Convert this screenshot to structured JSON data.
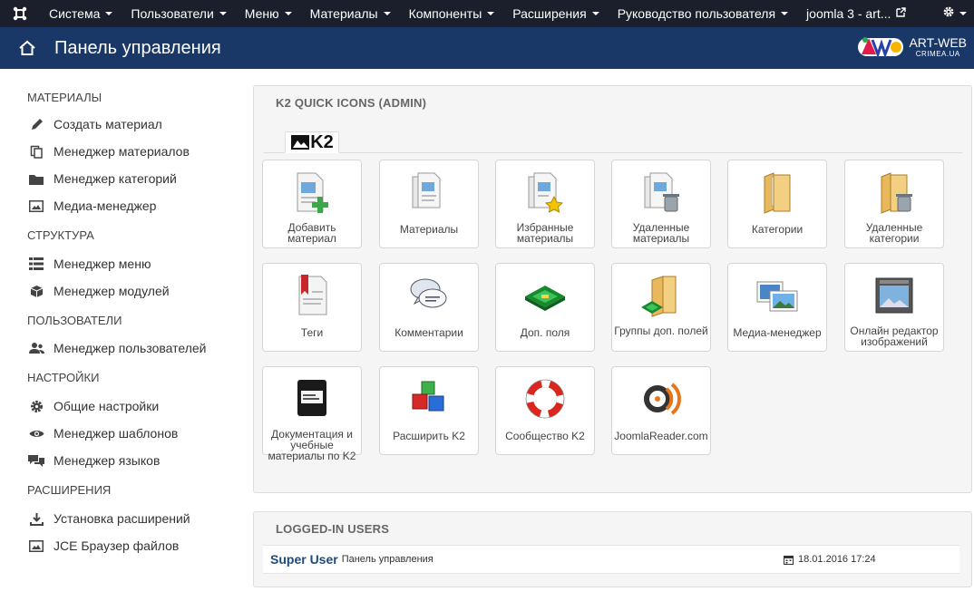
{
  "topnav": {
    "items": [
      {
        "label": "Система",
        "dropdown": true
      },
      {
        "label": "Пользователи",
        "dropdown": true
      },
      {
        "label": "Меню",
        "dropdown": true
      },
      {
        "label": "Материалы",
        "dropdown": true
      },
      {
        "label": "Компоненты",
        "dropdown": true
      },
      {
        "label": "Расширения",
        "dropdown": true
      },
      {
        "label": "Руководство пользователя",
        "dropdown": true
      }
    ],
    "site_link": "joomla 3 - art...",
    "icons": [
      "joomla-logo-icon",
      "external-link-icon",
      "gear-icon"
    ]
  },
  "header": {
    "title": "Панель управления",
    "brand_line1": "ART-WEB",
    "brand_line2": "CRIMEA.UA"
  },
  "sidebar": {
    "sections": [
      {
        "title": "МАТЕРИАЛЫ",
        "items": [
          {
            "label": "Создать материал",
            "icon": "pencil-icon"
          },
          {
            "label": "Менеджер материалов",
            "icon": "copy-icon"
          },
          {
            "label": "Менеджер категорий",
            "icon": "folder-icon"
          },
          {
            "label": "Медиа-менеджер",
            "icon": "image-icon"
          }
        ]
      },
      {
        "title": "СТРУКТУРА",
        "items": [
          {
            "label": "Менеджер меню",
            "icon": "list-icon"
          },
          {
            "label": "Менеджер модулей",
            "icon": "cube-icon"
          }
        ]
      },
      {
        "title": "ПОЛЬЗОВАТЕЛИ",
        "items": [
          {
            "label": "Менеджер пользователей",
            "icon": "users-icon"
          }
        ]
      },
      {
        "title": "НАСТРОЙКИ",
        "items": [
          {
            "label": "Общие настройки",
            "icon": "cog-icon"
          },
          {
            "label": "Менеджер шаблонов",
            "icon": "eye-icon"
          },
          {
            "label": "Менеджер языков",
            "icon": "comments-icon"
          }
        ]
      },
      {
        "title": "РАСШИРЕНИЯ",
        "items": [
          {
            "label": "Установка расширений",
            "icon": "download-icon"
          },
          {
            "label": "JCE Браузер файлов",
            "icon": "picture-icon"
          }
        ]
      }
    ]
  },
  "k2panel": {
    "title": "K2 QUICK ICONS (ADMIN)",
    "tab_label": "K2",
    "icons": [
      {
        "label": "Добавить материал",
        "icon": "add-item-icon"
      },
      {
        "label": "Материалы",
        "icon": "items-icon"
      },
      {
        "label": "Избранные материалы",
        "icon": "featured-items-icon"
      },
      {
        "label": "Удаленные материалы",
        "icon": "trashed-items-icon"
      },
      {
        "label": "Категории",
        "icon": "categories-icon"
      },
      {
        "label": "Удаленные категории",
        "icon": "trashed-categories-icon"
      },
      {
        "label": "Теги",
        "icon": "tags-icon"
      },
      {
        "label": "Комментарии",
        "icon": "comments-icon"
      },
      {
        "label": "Доп. поля",
        "icon": "extra-fields-icon"
      },
      {
        "label": "Группы доп. полей",
        "icon": "extra-field-groups-icon"
      },
      {
        "label": "Медиа-менеджер",
        "icon": "media-manager-icon"
      },
      {
        "label": "Онлайн редактор изображений",
        "icon": "image-editor-icon"
      },
      {
        "label": "Документация и учебные материалы по K2",
        "icon": "documentation-icon"
      },
      {
        "label": "Расширить K2",
        "icon": "extend-icon"
      },
      {
        "label": "Сообщество K2",
        "icon": "community-icon"
      },
      {
        "label": "JoomlaReader.com",
        "icon": "joomlareader-icon"
      }
    ]
  },
  "logged": {
    "title": "LOGGED-IN USERS",
    "user": "Super User",
    "location": "Панель управления",
    "datetime": "18.01.2016 17:24"
  }
}
